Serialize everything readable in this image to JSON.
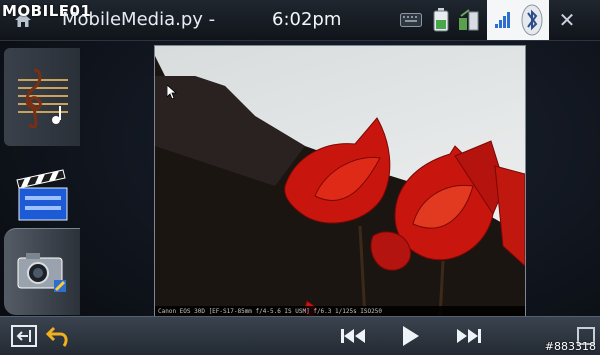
{
  "watermark": {
    "logo_text": "MOBILE01"
  },
  "titlebar": {
    "app_title": "MobileMedia.py -",
    "time": "6:02pm"
  },
  "tray_icons": [
    "keyboard-icon",
    "battery-icon",
    "network-icon",
    "signal-icon",
    "bluetooth-icon",
    "close-icon"
  ],
  "sidebar": {
    "items": [
      {
        "name": "music",
        "icon": "music-icon"
      },
      {
        "name": "video",
        "icon": "clapperboard-icon"
      },
      {
        "name": "photos",
        "icon": "camera-icon",
        "selected": true
      }
    ]
  },
  "viewer": {
    "exif_caption": "Canon EOS 30D [EF-S17-85mm f/4-5.6 IS USM] f/6.3 1/125s ISO250"
  },
  "controls": {
    "icons": [
      "exit-icon",
      "back-icon",
      "previous-icon",
      "play-icon",
      "next-icon",
      "fullscreen-icon"
    ]
  },
  "credit": {
    "text": "#883318"
  },
  "colors": {
    "accent_blue": "#2d6fd1",
    "tulip_red": "#d0201a"
  }
}
